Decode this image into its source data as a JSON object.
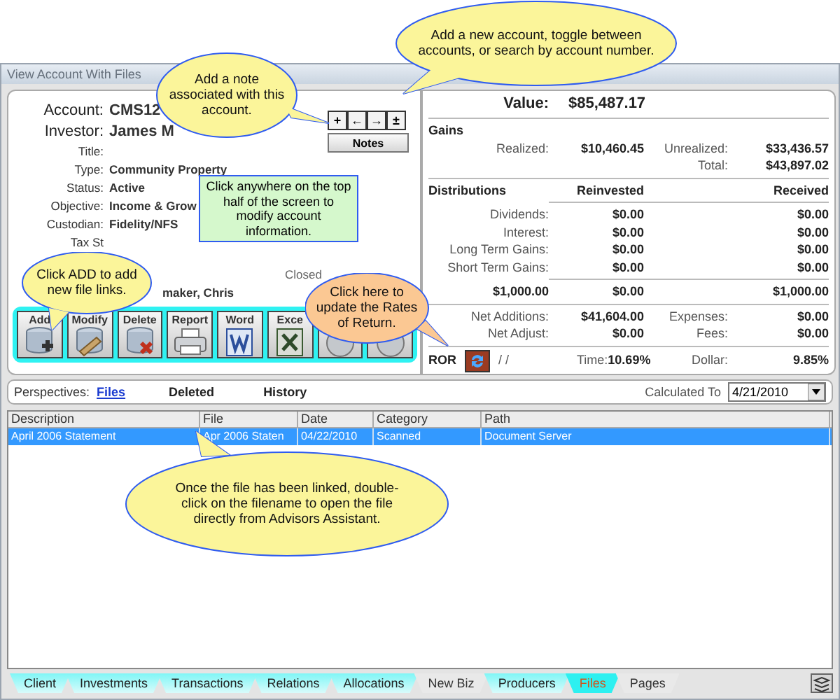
{
  "window": {
    "title": "View Account With Files"
  },
  "account_info": {
    "rows": [
      {
        "kind": "large",
        "label": "Account:",
        "value": "CMS12"
      },
      {
        "kind": "large",
        "label": "Investor:",
        "value": "James M"
      },
      {
        "kind": "small",
        "label": "Title:"
      },
      {
        "kind": "small",
        "label": "Type:",
        "value": "Community Property"
      },
      {
        "kind": "small",
        "label": "Status:",
        "value": "Active"
      },
      {
        "kind": "small",
        "label": "Objective:",
        "value": "Income & Grow"
      },
      {
        "kind": "small",
        "label": "Custodian:",
        "value": "Fidelity/NFS"
      },
      {
        "kind": "small",
        "label": "Tax St"
      }
    ],
    "closed_label": "Closed",
    "rep_fragment": "maker, Chris",
    "nav_buttons": [
      "+",
      "←",
      "→",
      "±"
    ],
    "notes_button": "Notes"
  },
  "toolbar": [
    {
      "kind": "db-add",
      "label": "Add"
    },
    {
      "kind": "db-edit",
      "label": "Modify"
    },
    {
      "kind": "db-delete",
      "label": "Delete"
    },
    {
      "kind": "printer",
      "label": "Report"
    },
    {
      "kind": "word",
      "label": "Word"
    },
    {
      "kind": "excel",
      "label": "Exce"
    },
    {
      "kind": "disc"
    },
    {
      "kind": "disc"
    }
  ],
  "summary": {
    "value_label": "Value:",
    "value": "$85,487.17",
    "gains": {
      "title": "Gains",
      "realized_label": "Realized:",
      "realized": "$10,460.45",
      "unrealized_label": "Unrealized:",
      "unrealized": "$33,436.57",
      "total_label": "Total:",
      "total": "$43,897.02"
    },
    "distributions": {
      "title": "Distributions",
      "col_reinvested": "Reinvested",
      "col_received": "Received",
      "rows": [
        {
          "label": "Dividends:",
          "reinvested": "$0.00",
          "received": "$0.00"
        },
        {
          "label": "Interest:",
          "reinvested": "$0.00",
          "received": "$0.00"
        },
        {
          "label": "Long Term Gains:",
          "reinvested": "$0.00",
          "received": "$0.00"
        },
        {
          "label": "Short Term Gains:",
          "reinvested": "$0.00",
          "received": "$0.00"
        }
      ],
      "totals": {
        "first": "$1,000.00",
        "reinvested": "$0.00",
        "received": "$1,000.00"
      }
    },
    "net": [
      {
        "label": "Net Additions:",
        "value": "$41,604.00",
        "label2": "Expenses:",
        "value2": "$0.00"
      },
      {
        "label": "Net Adjust:",
        "value": "$0.00",
        "label2": "Fees:",
        "value2": "$0.00"
      }
    ],
    "ror": {
      "label": "ROR",
      "date": "/ /",
      "time_label": "Time:",
      "time": "10.69%",
      "dollar_label": "Dollar:",
      "dollar": "9.85%"
    }
  },
  "perspectives": {
    "label": "Perspectives:",
    "items": [
      {
        "label": "Files",
        "selected": true
      },
      {
        "label": "Deleted",
        "selected": false
      },
      {
        "label": "History",
        "selected": false
      }
    ],
    "calculated_label": "Calculated To",
    "calculated_value": "4/21/2010"
  },
  "table": {
    "columns": [
      "Description",
      "File",
      "Date",
      "Category",
      "Path"
    ],
    "rows": [
      {
        "selected": true,
        "cells": [
          "April 2006 Statement",
          "Apr 2006 Staten",
          "04/22/2010",
          "Scanned",
          "Document Server"
        ]
      }
    ]
  },
  "tabs": [
    {
      "label": "Client",
      "selected": false,
      "has_data": true
    },
    {
      "label": "Investments",
      "selected": false,
      "has_data": true
    },
    {
      "label": "Transactions",
      "selected": false,
      "has_data": true
    },
    {
      "label": "Relations",
      "selected": false,
      "has_data": true
    },
    {
      "label": "Allocations",
      "selected": false,
      "has_data": true
    },
    {
      "label": "New Biz",
      "selected": false,
      "has_data": false
    },
    {
      "label": "Producers",
      "selected": false,
      "has_data": true
    },
    {
      "label": "Files",
      "selected": true,
      "has_data": true
    },
    {
      "label": "Pages",
      "selected": false,
      "has_data": false
    }
  ],
  "callouts": [
    {
      "kind": "yellow",
      "text": "Add a new account, toggle between accounts, or search by account number."
    },
    {
      "kind": "yellow",
      "text": "Add a note associated with this account."
    },
    {
      "kind": "green",
      "text": "Click anywhere on the top half of the screen to modify account information."
    },
    {
      "kind": "yellow",
      "text": "Click ADD to add new file links."
    },
    {
      "kind": "orange",
      "text": "Click here to update the Rates of Return."
    },
    {
      "kind": "yellow",
      "text": "Once the file has been linked, double-click on the filename to open the file directly from Advisors Assistant."
    }
  ]
}
